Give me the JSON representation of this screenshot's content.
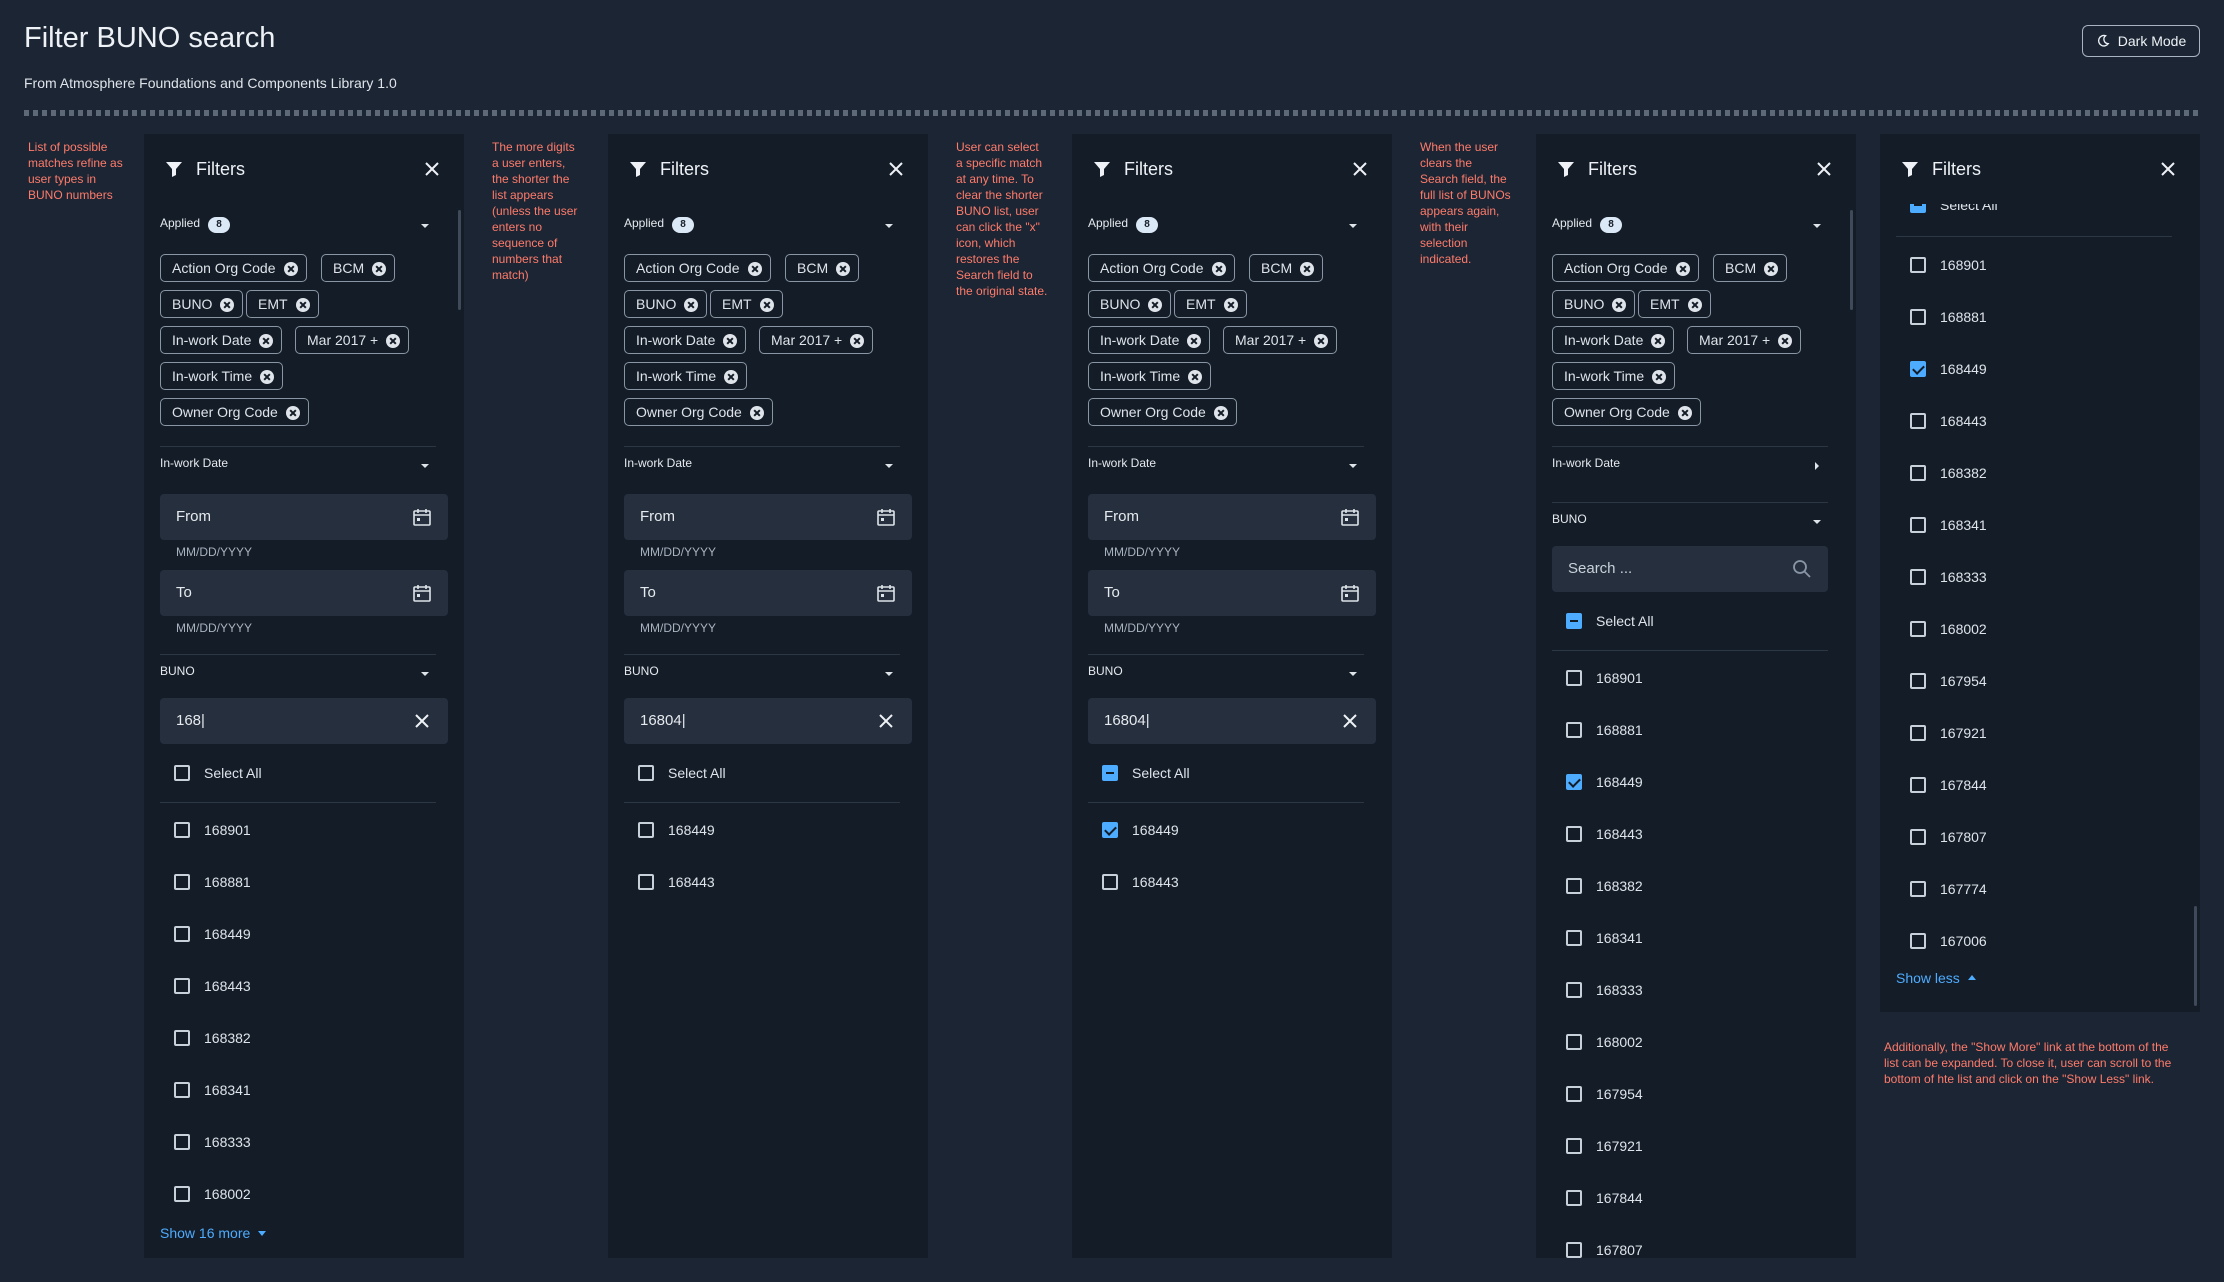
{
  "page": {
    "title": "Filter BUNO search",
    "subtitle": "From Atmosphere Foundations and Components Library 1.0",
    "dark_mode_label": "Dark Mode"
  },
  "notes": {
    "n1": "List of possible matches refine as user types in BUNO numbers",
    "n2": "The more digits a user enters, the shorter the list appears (unless the user enters no sequence of numbers that match)",
    "n3": "User can select a specific match at any time. To clear the shorter BUNO list, user can click the \"x\" icon, which restores the Search field to the original state.",
    "n4": "When the user clears the Search field, the full list of BUNOs appears again, with their selection indicated.",
    "n5": "Additionally, the \"Show More\" link at the bottom of the list can be expanded. To close it, user can scroll to the bottom of hte list and click on the \"Show Less\" link."
  },
  "common": {
    "filters_title": "Filters",
    "applied_label": "Applied",
    "applied_count": "8",
    "chips": [
      "Action Org Code",
      "BCM",
      "BUNO",
      "EMT",
      "In-work Date",
      "Mar 2017 +",
      "In-work Time",
      "Owner Org Code"
    ],
    "inwork_date_label": "In-work Date",
    "from_label": "From",
    "to_label": "To",
    "date_hint": "MM/DD/YYYY",
    "buno_label": "BUNO",
    "select_all": "Select All",
    "search_placeholder": "Search ...",
    "show_more": "Show 16 more",
    "show_less": "Show less"
  },
  "panel1": {
    "search_value": "168|",
    "items": [
      "168901",
      "168881",
      "168449",
      "168443",
      "168382",
      "168341",
      "168333",
      "168002"
    ]
  },
  "panel2": {
    "search_value": "16804|",
    "items": [
      "168449",
      "168443"
    ]
  },
  "panel3": {
    "search_value": "16804|",
    "items": [
      "168449",
      "168443"
    ],
    "checked": [
      "168449"
    ]
  },
  "panel4": {
    "items": [
      "168901",
      "168881",
      "168449",
      "168443",
      "168382",
      "168341",
      "168333",
      "168002",
      "167954",
      "167921",
      "167844",
      "167807"
    ],
    "checked": [
      "168449"
    ]
  },
  "panel5": {
    "items": [
      "168901",
      "168881",
      "168449",
      "168443",
      "168382",
      "168341",
      "168333",
      "168002",
      "167954",
      "167921",
      "167844",
      "167807",
      "167774",
      "167006"
    ],
    "checked": [
      "168449"
    ]
  },
  "colors": {
    "background": "#1b2533",
    "panel": "#141c27",
    "accent": "#4dacff",
    "note": "#ff7b6b"
  }
}
